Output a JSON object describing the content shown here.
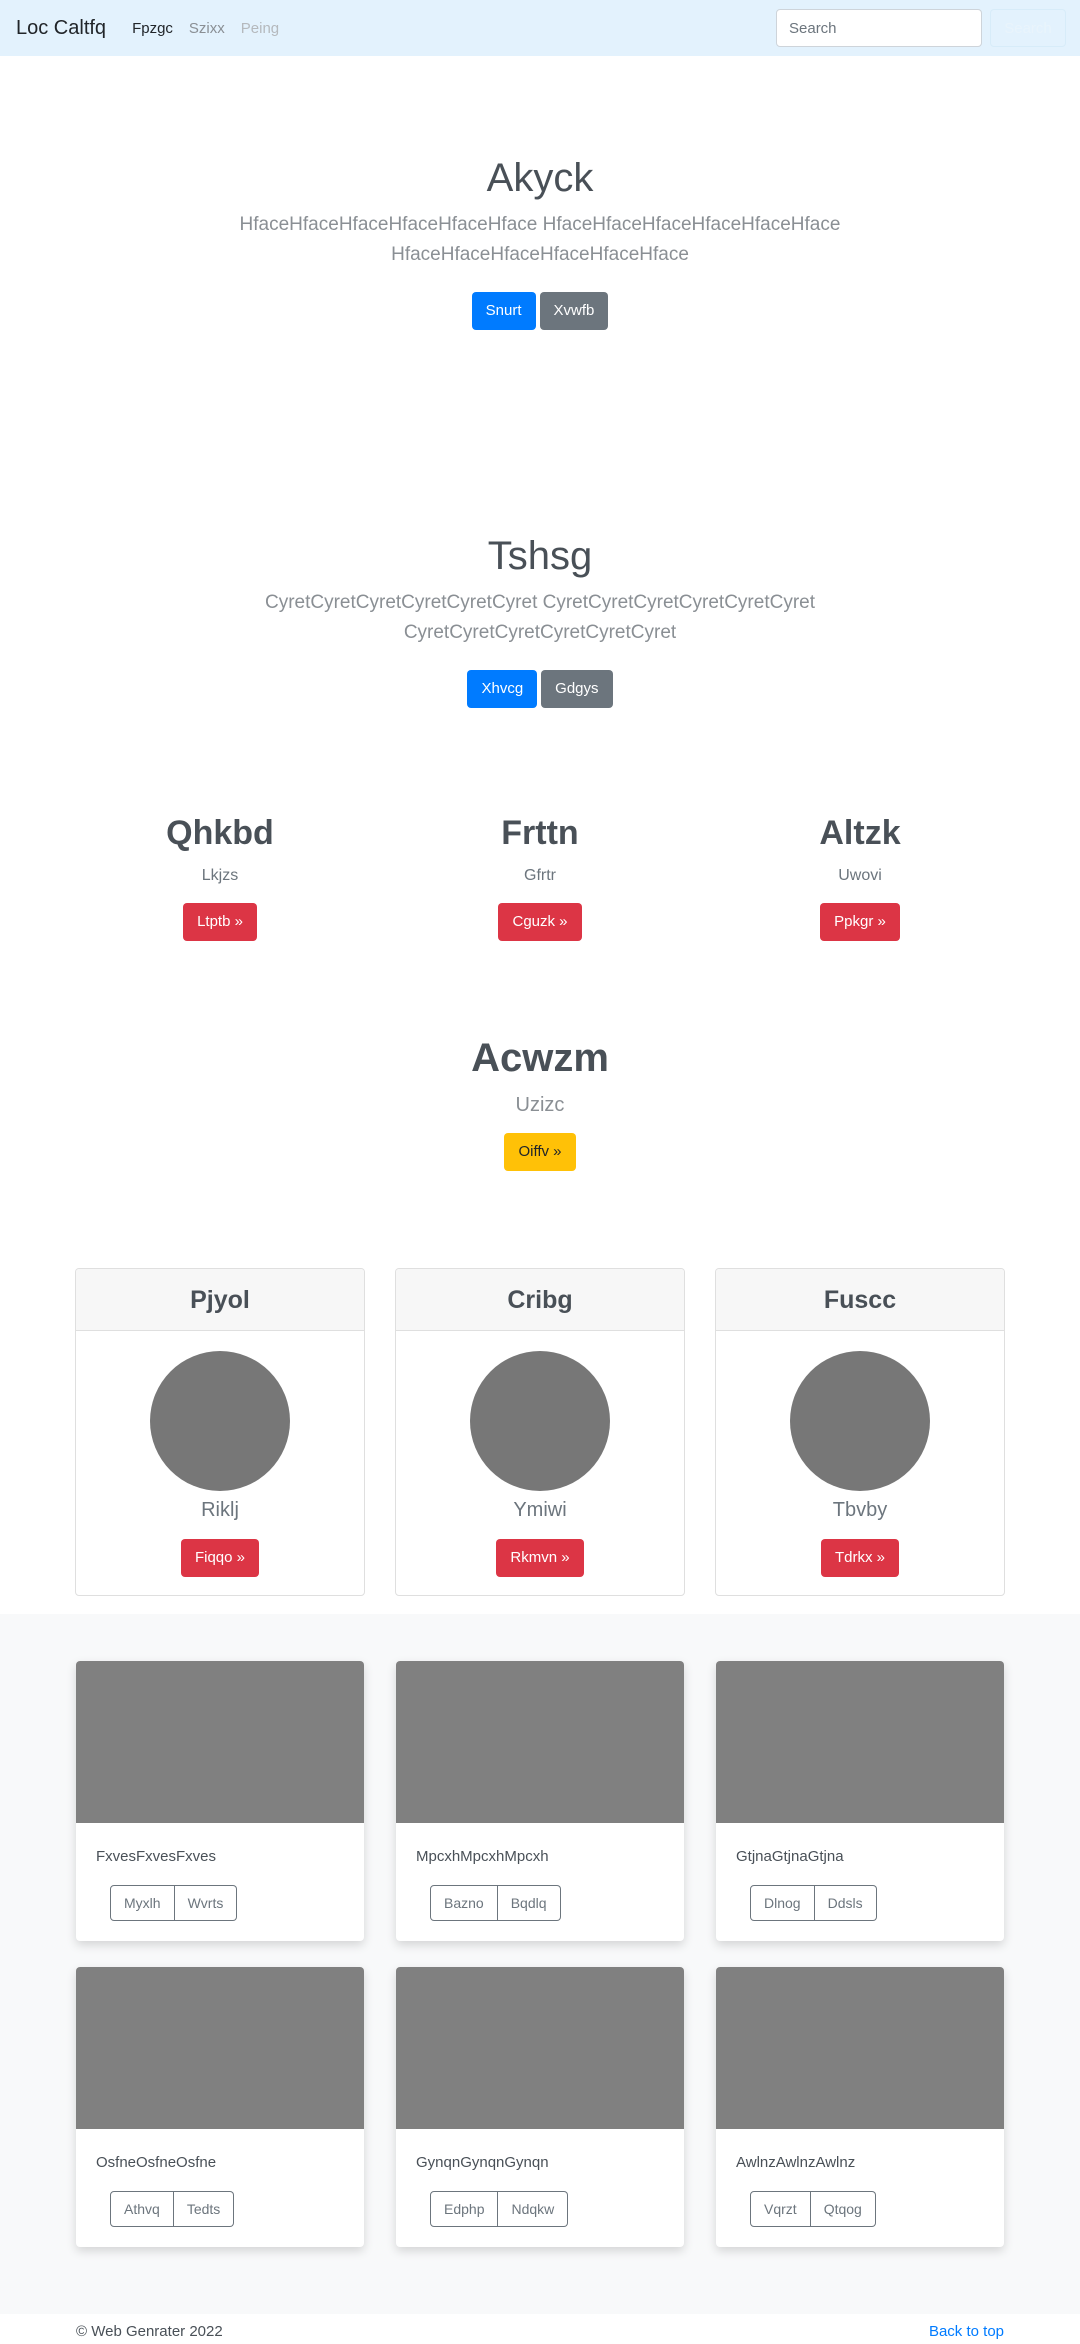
{
  "navbar": {
    "brand": "Loc Caltfq",
    "links": [
      "Fpzgc",
      "Szixx",
      "Peing"
    ],
    "search_placeholder": "Search",
    "search_button": "Search"
  },
  "hero1": {
    "title": "Akyck",
    "lead_line1": "HfaceHfaceHfaceHfaceHfaceHface HfaceHfaceHfaceHfaceHfaceHface",
    "lead_line2": "HfaceHfaceHfaceHfaceHfaceHface",
    "primary_button": "Snurt",
    "secondary_button": "Xvwfb"
  },
  "hero2": {
    "title": "Tshsg",
    "lead_line1": "CyretCyretCyretCyretCyretCyret CyretCyretCyretCyretCyretCyret",
    "lead_line2": "CyretCyretCyretCyretCyretCyret",
    "primary_button": "Xhvcg",
    "secondary_button": "Gdgys"
  },
  "columns": [
    {
      "title": "Qhkbd",
      "text": "Lkjzs",
      "button": "Ltptb »"
    },
    {
      "title": "Frttn",
      "text": "Gfrtr",
      "button": "Cguzk »"
    },
    {
      "title": "Altzk",
      "text": "Uwovi",
      "button": "Ppkgr »"
    }
  ],
  "feature": {
    "title": "Acwzm",
    "text": "Uzizc",
    "button": "Oiffv »"
  },
  "pricing": [
    {
      "header": "Pjyol",
      "text": "Riklj",
      "button": "Fiqqo »"
    },
    {
      "header": "Cribg",
      "text": "Ymiwi",
      "button": "Rkmvn »"
    },
    {
      "header": "Fuscc",
      "text": "Tbvby",
      "button": "Tdrkx »"
    }
  ],
  "album": [
    {
      "text": "FxvesFxvesFxves",
      "btn1": "Myxlh",
      "btn2": "Wvrts"
    },
    {
      "text": "MpcxhMpcxhMpcxh",
      "btn1": "Bazno",
      "btn2": "Bqdlq"
    },
    {
      "text": "GtjnaGtjnaGtjna",
      "btn1": "Dlnog",
      "btn2": "Ddsls"
    },
    {
      "text": "OsfneOsfneOsfne",
      "btn1": "Athvq",
      "btn2": "Tedts"
    },
    {
      "text": "GynqnGynqnGynqn",
      "btn1": "Edphp",
      "btn2": "Ndqkw"
    },
    {
      "text": "AwlnzAwlnzAwlnz",
      "btn1": "Vqrzt",
      "btn2": "Qtqog"
    }
  ],
  "footer": {
    "copyright": "© Web Genrater 2022",
    "back_to_top": "Back to top"
  }
}
